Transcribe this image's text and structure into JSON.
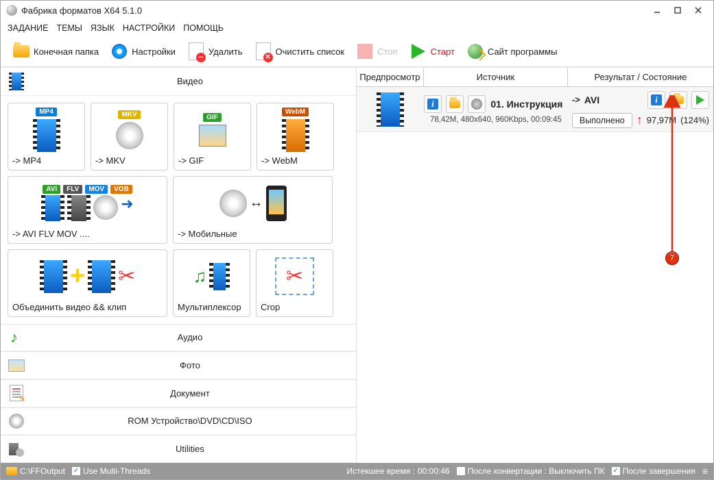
{
  "window": {
    "title": "Фабрика форматов X64 5.1.0"
  },
  "menu": {
    "task": "ЗАДАНИЕ",
    "themes": "ТЕМЫ",
    "lang": "ЯЗЫК",
    "settings": "НАСТРОЙКИ",
    "help": "ПОМОЩЬ"
  },
  "toolbar": {
    "out_folder": "Конечная папка",
    "settings": "Настройки",
    "delete": "Удалить",
    "clear": "Очистить список",
    "stop": "Стоп",
    "start": "Старт",
    "site": "Сайт программы"
  },
  "categories": {
    "video": "Видео",
    "audio": "Аудио",
    "photo": "Фото",
    "document": "Документ",
    "rom": "ROM Устройство\\DVD\\CD\\ISO",
    "utilities": "Utilities"
  },
  "tiles": {
    "mp4": {
      "badge": "MP4",
      "label": "-> MP4"
    },
    "mkv": {
      "badge": "MKV",
      "label": "-> MKV"
    },
    "gif": {
      "badge": "GIF",
      "label": "-> GIF"
    },
    "webm": {
      "badge": "WebM",
      "label": "-> WebM"
    },
    "aviflv": {
      "b1": "AVI",
      "b2": "FLV",
      "b3": "MOV",
      "b4": "VOB",
      "label": "-> AVI FLV MOV ...."
    },
    "mobile": {
      "label": "-> Мобильные"
    },
    "join": {
      "label": "Объединить видео && клип"
    },
    "mux": {
      "label": "Мультиплексор"
    },
    "crop": {
      "label": "Crop"
    }
  },
  "rhead": {
    "preview": "Предпросмотр",
    "source": "Источник",
    "result": "Результат / Состояние"
  },
  "job": {
    "title": "01. Инструкция",
    "meta": "78,42M, 480x640, 960Kbps, 00:09:45",
    "target": "AVI",
    "done": "Выполнено",
    "size": "97,97M",
    "pct": "(124%)"
  },
  "annotation": {
    "num": "7"
  },
  "status": {
    "out_path": "C:\\FFOutput",
    "threads": "Use Multi-Threads",
    "elapsed_label": "Истекшее время : ",
    "elapsed_val": "00:00:46",
    "after_conv": "После конвертации : Выключить ПК",
    "after_done": "После завершения"
  }
}
